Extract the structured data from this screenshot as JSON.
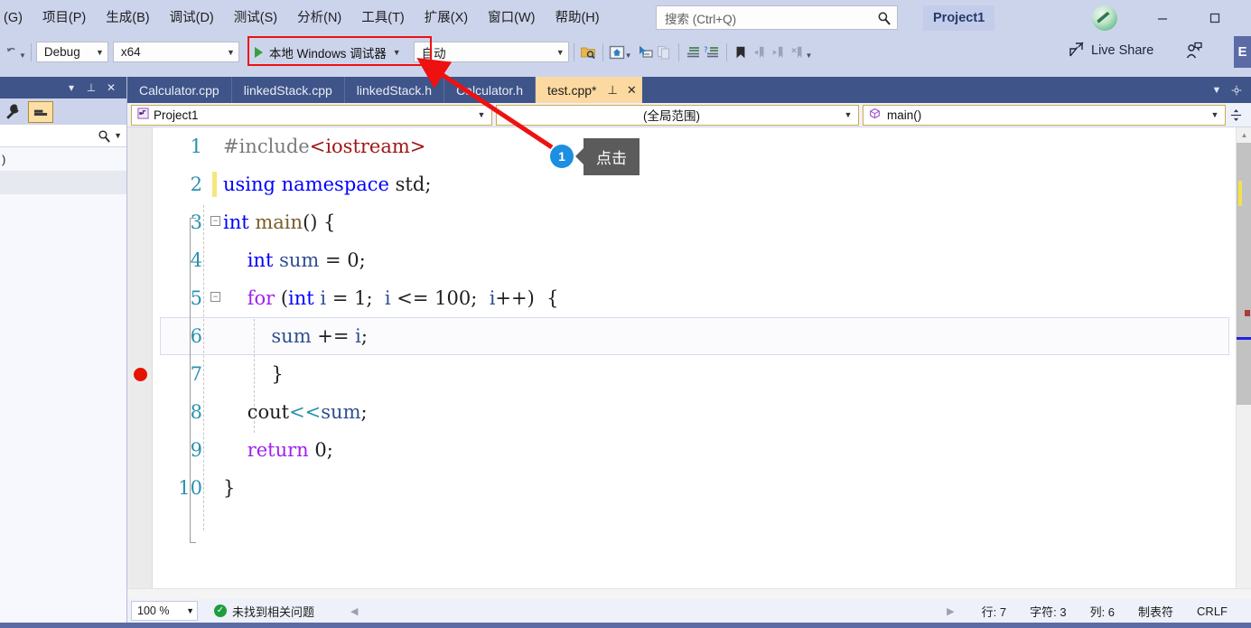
{
  "menu": {
    "items": [
      {
        "label": "(G)"
      },
      {
        "label": "项目(P)"
      },
      {
        "label": "生成(B)"
      },
      {
        "label": "调试(D)"
      },
      {
        "label": "测试(S)"
      },
      {
        "label": "分析(N)"
      },
      {
        "label": "工具(T)"
      },
      {
        "label": "扩展(X)"
      },
      {
        "label": "窗口(W)"
      },
      {
        "label": "帮助(H)"
      }
    ]
  },
  "titlebar": {
    "search_placeholder": "搜索 (Ctrl+Q)",
    "project_name": "Project1",
    "minimize_label": "—",
    "maximize_label": "▢"
  },
  "toolbar": {
    "config": "Debug",
    "platform": "x64",
    "run_label": "本地 Windows 调试器",
    "auto": "自动",
    "live_share": "Live Share",
    "edge_label": "E",
    "icons": [
      "solution-explorer-icon",
      "home-icon",
      "pointer-select-icon",
      "copy-icon",
      "comment-icon",
      "uncomment-icon",
      "bookmark-icon",
      "prev-bookmark-icon",
      "next-bookmark-icon",
      "clear-bookmark-icon"
    ]
  },
  "left_panel": {
    "caption_buttons": [
      "▾",
      "⊥",
      "✕"
    ],
    "tool_icons": [
      "wrench-icon",
      "properties-icon"
    ],
    "rows": [
      {
        "label": ")"
      },
      {
        "label": ""
      },
      {
        "label": ""
      }
    ]
  },
  "tabs": [
    {
      "label": "Calculator.cpp",
      "active": false
    },
    {
      "label": "linkedStack.cpp",
      "active": false
    },
    {
      "label": "linkedStack.h",
      "active": false
    },
    {
      "label": "Calculator.h",
      "active": false
    },
    {
      "label": "test.cpp*",
      "active": true
    }
  ],
  "navbar": {
    "project": "Project1",
    "scope": "(全局范围)",
    "member": "main()"
  },
  "code": {
    "lines": [
      {
        "num": "1",
        "tokens": [
          {
            "t": "#include",
            "c": "k-pp"
          },
          {
            "t": "<iostream>",
            "c": "k-str"
          }
        ]
      },
      {
        "num": "2",
        "tokens": [
          {
            "t": "using namespace",
            "c": "k-key"
          },
          {
            "t": " std;",
            "c": "k-id"
          }
        ]
      },
      {
        "num": "3",
        "tokens": [
          {
            "t": "int",
            "c": "k-key"
          },
          {
            "t": " ",
            "c": "k-id"
          },
          {
            "t": "main",
            "c": "k-fn"
          },
          {
            "t": "() {",
            "c": "k-id"
          }
        ]
      },
      {
        "num": "4",
        "tokens": [
          {
            "t": "    ",
            "c": "k-id"
          },
          {
            "t": "int",
            "c": "k-key"
          },
          {
            "t": " ",
            "c": "k-id"
          },
          {
            "t": "sum",
            "c": "k-var"
          },
          {
            "t": " = ",
            "c": "k-op"
          },
          {
            "t": "0",
            "c": "k-num"
          },
          {
            "t": ";",
            "c": "k-op"
          }
        ]
      },
      {
        "num": "5",
        "tokens": [
          {
            "t": "    ",
            "c": "k-id"
          },
          {
            "t": "for",
            "c": "k-kw2"
          },
          {
            "t": " (",
            "c": "k-op"
          },
          {
            "t": "int",
            "c": "k-key"
          },
          {
            "t": " ",
            "c": "k-id"
          },
          {
            "t": "i",
            "c": "k-var"
          },
          {
            "t": " = ",
            "c": "k-op"
          },
          {
            "t": "1",
            "c": "k-num"
          },
          {
            "t": ";  ",
            "c": "k-op"
          },
          {
            "t": "i",
            "c": "k-var"
          },
          {
            "t": " <= ",
            "c": "k-op"
          },
          {
            "t": "100",
            "c": "k-num"
          },
          {
            "t": ";  ",
            "c": "k-op"
          },
          {
            "t": "i",
            "c": "k-var"
          },
          {
            "t": "++)  {",
            "c": "k-op"
          }
        ]
      },
      {
        "num": "6",
        "tokens": [
          {
            "t": "        ",
            "c": "k-id"
          },
          {
            "t": "sum",
            "c": "k-var"
          },
          {
            "t": " += ",
            "c": "k-op"
          },
          {
            "t": "i",
            "c": "k-var"
          },
          {
            "t": ";",
            "c": "k-op"
          }
        ]
      },
      {
        "num": "7",
        "tokens": [
          {
            "t": "        }",
            "c": "k-op"
          }
        ]
      },
      {
        "num": "8",
        "tokens": [
          {
            "t": "    ",
            "c": "k-id"
          },
          {
            "t": "cout",
            "c": "k-id"
          },
          {
            "t": "<<",
            "c": "k-cls"
          },
          {
            "t": "sum",
            "c": "k-var"
          },
          {
            "t": ";",
            "c": "k-op"
          }
        ]
      },
      {
        "num": "9",
        "tokens": [
          {
            "t": "    ",
            "c": "k-id"
          },
          {
            "t": "return",
            "c": "k-kw2"
          },
          {
            "t": " ",
            "c": "k-id"
          },
          {
            "t": "0",
            "c": "k-num"
          },
          {
            "t": ";",
            "c": "k-op"
          }
        ]
      },
      {
        "num": "10",
        "tokens": [
          {
            "t": "}",
            "c": "k-op"
          }
        ]
      }
    ],
    "breakpoint_line": "6"
  },
  "statusbar": {
    "zoom": "100 %",
    "problems": "未找到相关问题",
    "row_label": "行: 7",
    "char_label": "字符: 3",
    "col_label": "列: 6",
    "tab_label": "制表符",
    "eol_label": "CRLF"
  },
  "annotation": {
    "badge": "1",
    "tooltip": "点击",
    "highlight_color": "#ee1111",
    "arrow_color": "#ee1111"
  }
}
